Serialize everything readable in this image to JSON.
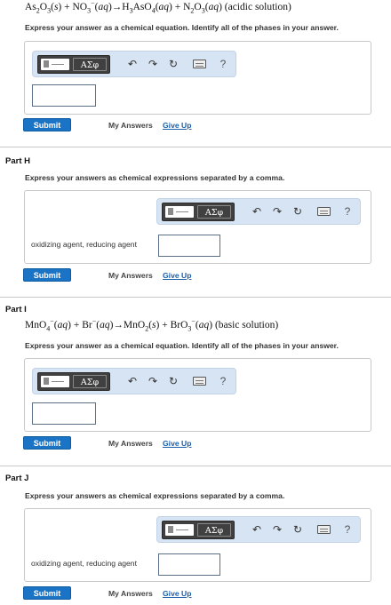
{
  "toolbar": {
    "greek_label": "ΑΣφ",
    "undo_glyph": "↶",
    "redo_glyph": "↷",
    "reset_glyph": "↻",
    "help_label": "?",
    "icons": [
      "templates-icon",
      "greek-letters-icon",
      "undo-icon",
      "redo-icon",
      "reset-icon",
      "keyboard-icon",
      "help-icon"
    ]
  },
  "buttons": {
    "submit": "Submit",
    "my_answers": "My Answers",
    "give_up": "Give Up"
  },
  "part_g": {
    "instruction": "Express your answer as a chemical equation. Identify all of the phases in your answer."
  },
  "part_h": {
    "label": "Part H",
    "instruction": "Express your answers as chemical expressions separated by a comma.",
    "field_label": "oxidizing agent, reducing agent"
  },
  "part_i": {
    "label": "Part I",
    "instruction": "Express your answer as a chemical equation. Identify all of the phases in your answer."
  },
  "part_j": {
    "label": "Part J",
    "instruction": "Express your answers as chemical expressions separated by a comma.",
    "field_label": "oxidizing agent, reducing agent"
  },
  "colors": {
    "toolbar_bg": "#d7e4f3",
    "submit_bg": "#1a73c4",
    "link": "#1a5fa8"
  }
}
